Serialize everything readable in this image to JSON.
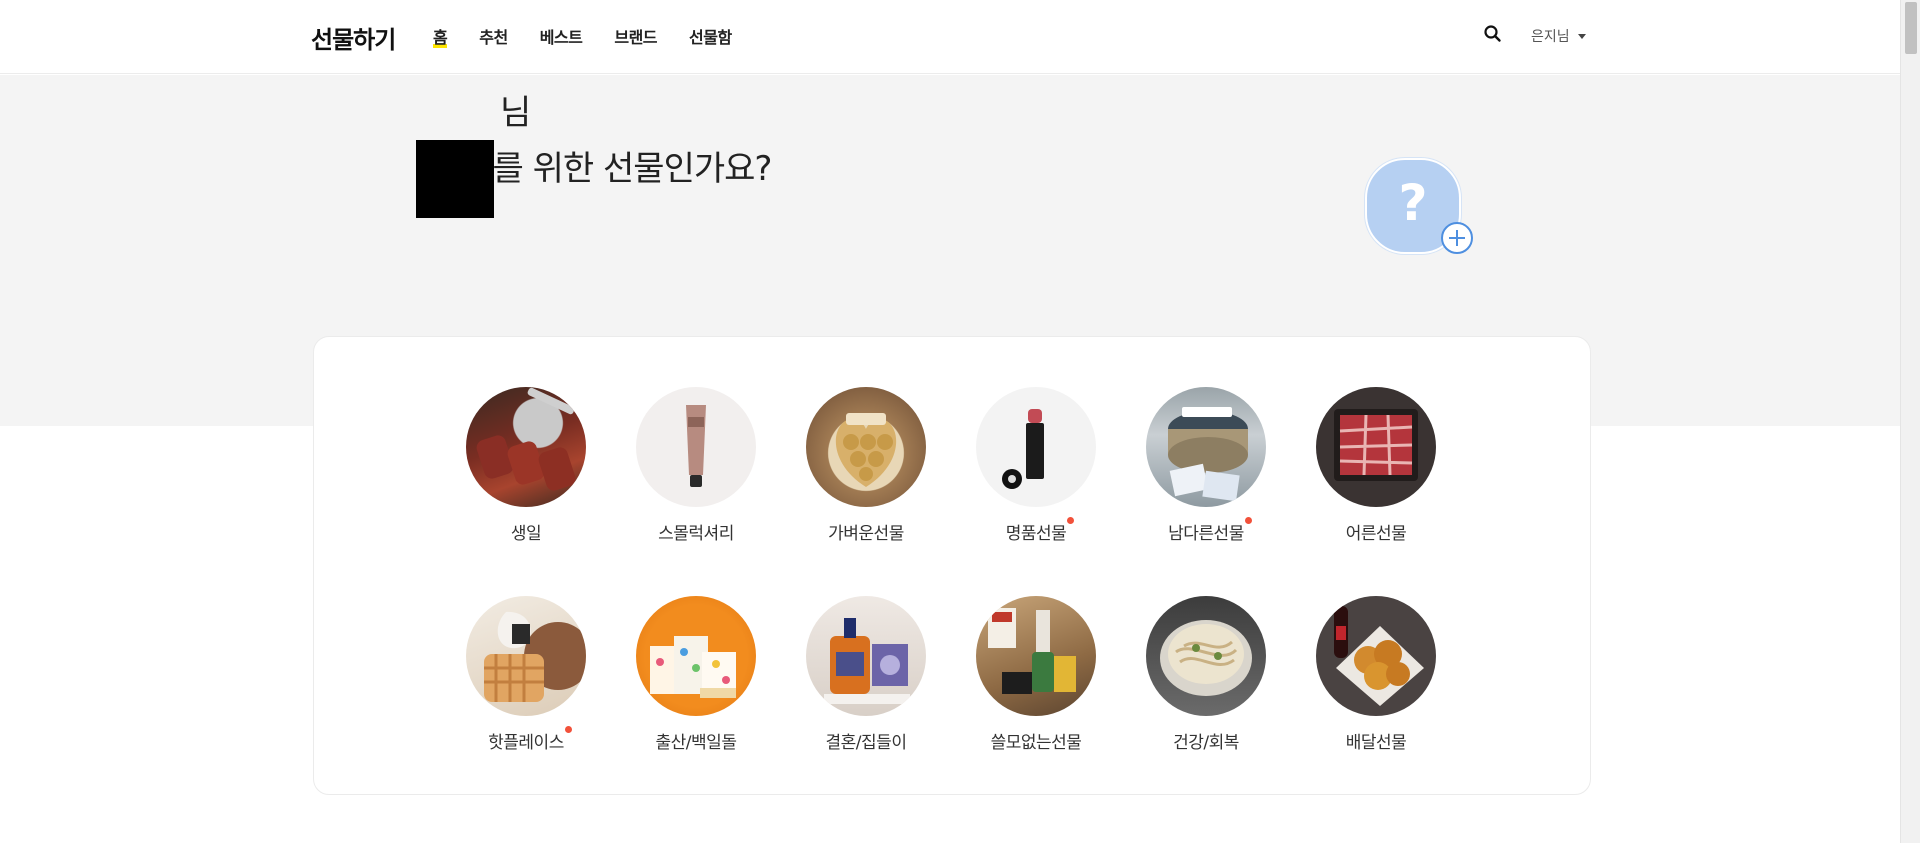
{
  "header": {
    "brand": "선물하기",
    "nav": [
      "홈",
      "추천",
      "베스트",
      "브랜드",
      "선물함"
    ],
    "active_index": 0,
    "user_label": "은지님"
  },
  "hero": {
    "greeting_suffix": "님",
    "question": "누구를 위한 선물인가요?",
    "avatar_symbol": "?"
  },
  "categories": [
    {
      "label": "생일",
      "dot": false,
      "icon": "grilled-meat"
    },
    {
      "label": "스몰럭셔리",
      "dot": false,
      "icon": "cosmetic-tube"
    },
    {
      "label": "가벼운선물",
      "dot": false,
      "icon": "chocolate-box"
    },
    {
      "label": "명품선물",
      "dot": true,
      "icon": "lipstick"
    },
    {
      "label": "남다른선물",
      "dot": true,
      "icon": "tin-can"
    },
    {
      "label": "어른선물",
      "dot": false,
      "icon": "beef-box"
    },
    {
      "label": "핫플레이스",
      "dot": true,
      "icon": "waffle"
    },
    {
      "label": "출산/백일돌",
      "dot": false,
      "icon": "gift-set"
    },
    {
      "label": "결혼/집들이",
      "dot": false,
      "icon": "soap-set"
    },
    {
      "label": "쓸모없는선물",
      "dot": false,
      "icon": "novelty-items"
    },
    {
      "label": "건강/회복",
      "dot": false,
      "icon": "noodle-bowl"
    },
    {
      "label": "배달선물",
      "dot": false,
      "icon": "fried-chicken"
    }
  ],
  "colors": {
    "accent": "#fee500",
    "dot": "#f2513a",
    "hero_bg": "#f4f4f4",
    "avatar_bg": "#b6d0f2",
    "plus": "#4e8fe0"
  }
}
